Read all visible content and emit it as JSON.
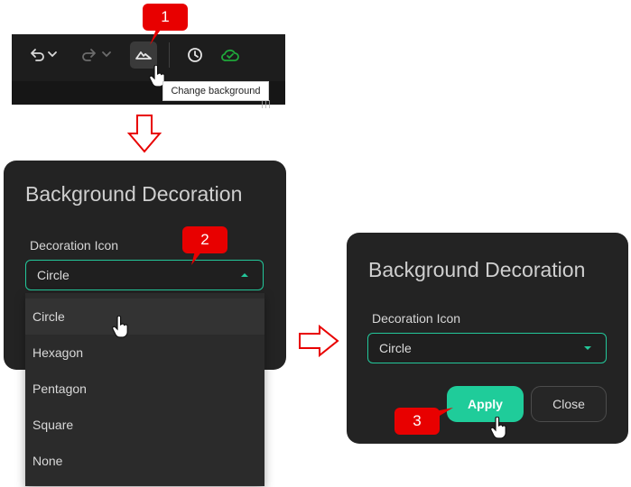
{
  "callouts": {
    "step1": "1",
    "step2": "2",
    "step3": "3"
  },
  "toolbar": {
    "undo_icon": "undo-icon",
    "redo_icon": "redo-icon",
    "background_icon": "mountain-icon",
    "history_icon": "clock-icon",
    "cloud_icon": "cloud-check-icon",
    "cloud_color": "#1fa83a",
    "tooltip": "Change background"
  },
  "dialog_open": {
    "title": "Background Decoration",
    "field_label": "Decoration Icon",
    "selected_value": "Circle",
    "options": [
      "Circle",
      "Hexagon",
      "Pentagon",
      "Square",
      "None"
    ],
    "hovered_option": "Circle"
  },
  "dialog_final": {
    "title": "Background Decoration",
    "field_label": "Decoration Icon",
    "selected_value": "Circle",
    "apply_label": "Apply",
    "close_label": "Close"
  },
  "colors": {
    "accent": "#1fcc9a",
    "callout": "#e80000",
    "dialog_bg": "#232323"
  }
}
